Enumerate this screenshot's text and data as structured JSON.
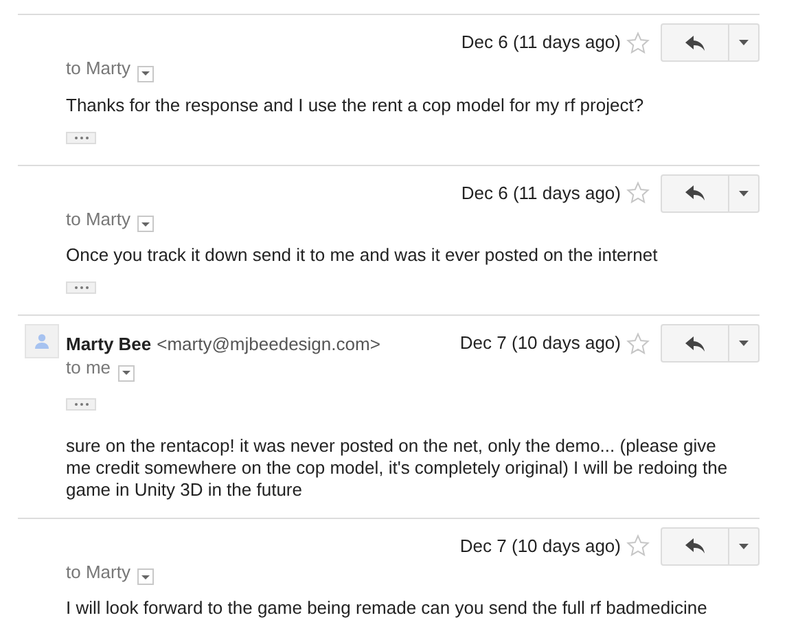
{
  "messages": [
    {
      "date": "Dec 6 (11 days ago)",
      "starred": false,
      "recipient": "to Marty",
      "body": "Thanks for the response and I use the rent a cop model for my rf project?",
      "kind": "sent",
      "trimmed_content": true
    },
    {
      "date": "Dec 6 (11 days ago)",
      "starred": false,
      "recipient": "to Marty",
      "body": "Once you track it down send it to me and was it ever posted on the internet",
      "kind": "sent",
      "trimmed_content": true
    },
    {
      "sender": {
        "name": "Marty Bee",
        "email": "<marty@mjbeedesign.com>"
      },
      "date": "Dec 7 (10 days ago)",
      "starred": false,
      "recipient": "to me",
      "body": "sure on the rentacop! it was never posted on the net, only the demo... (please give me credit somewhere on the cop model, it's completely original) I will be redoing the game in Unity 3D in the future",
      "kind": "received",
      "trimmed_content": true
    },
    {
      "date": "Dec 7 (10 days ago)",
      "starred": false,
      "recipient": "to Marty",
      "body": "I will look forward to the game being remade can you send the full rf badmedicine",
      "kind": "sent"
    }
  ]
}
